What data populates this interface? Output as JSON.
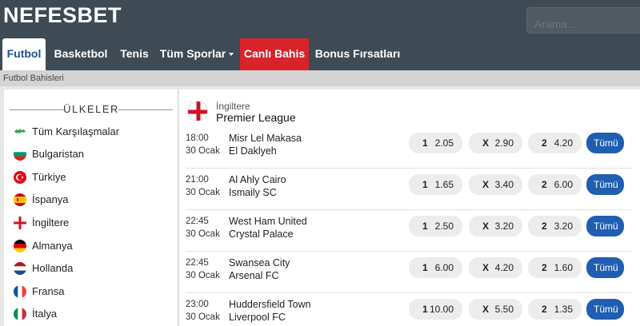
{
  "brand": "NEFESBET",
  "search": {
    "placeholder": "Arama..."
  },
  "nav": {
    "tabs": [
      {
        "label": "Futbol"
      },
      {
        "label": "Basketbol"
      },
      {
        "label": "Tenis"
      },
      {
        "label": "Tüm Sporlar"
      },
      {
        "label": "Canlı Bahis"
      },
      {
        "label": "Bonus Fırsatları"
      }
    ]
  },
  "breadcrumb": "Futbol Bahisleri",
  "sidebar": {
    "title": "ÜLKELER",
    "countries": [
      {
        "name": "Tüm Karşılaşmalar",
        "icon": "world-map-icon"
      },
      {
        "name": "Bulgaristan",
        "icon": "flag-bulgaria-icon"
      },
      {
        "name": "Türkiye",
        "icon": "flag-turkey-icon"
      },
      {
        "name": "İspanya",
        "icon": "flag-spain-icon"
      },
      {
        "name": "İngiltere",
        "icon": "flag-england-icon"
      },
      {
        "name": "Almanya",
        "icon": "flag-germany-icon"
      },
      {
        "name": "Hollanda",
        "icon": "flag-netherlands-icon"
      },
      {
        "name": "Fransa",
        "icon": "flag-france-icon"
      },
      {
        "name": "İtalya",
        "icon": "flag-italy-icon"
      }
    ]
  },
  "league": {
    "country": "İngiltere",
    "name": "Premier League",
    "icon": "flag-england-icon"
  },
  "odds_labels": {
    "home": "1",
    "draw": "X",
    "away": "2"
  },
  "more_label": "Tümü",
  "matches": [
    {
      "time": "18:00",
      "date": "30 Ocak",
      "home": "Misr Lel Makasa",
      "away": "El Daklyeh",
      "o1": "2.05",
      "ox": "2.90",
      "o2": "4.20"
    },
    {
      "time": "21:00",
      "date": "30 Ocak",
      "home": "Al Ahly Cairo",
      "away": "Ismaily SC",
      "o1": "1.65",
      "ox": "3.40",
      "o2": "6.00"
    },
    {
      "time": "22:45",
      "date": "30 Ocak",
      "home": "West Ham United",
      "away": "Crystal Palace",
      "o1": "2.50",
      "ox": "3.20",
      "o2": "3.20"
    },
    {
      "time": "22:45",
      "date": "30 Ocak",
      "home": "Swansea City",
      "away": "Arsenal FC",
      "o1": "6.00",
      "ox": "4.20",
      "o2": "1.60"
    },
    {
      "time": "23:00",
      "date": "30 Ocak",
      "home": "Huddersfield Town",
      "away": "Liverpool FC",
      "o1": "10.00",
      "ox": "5.50",
      "o2": "1.35"
    }
  ],
  "colors": {
    "topbar": "#3e4a54",
    "live": "#d8232a",
    "button": "#1f5eb0",
    "active_tab_text": "#1f4f8f"
  }
}
